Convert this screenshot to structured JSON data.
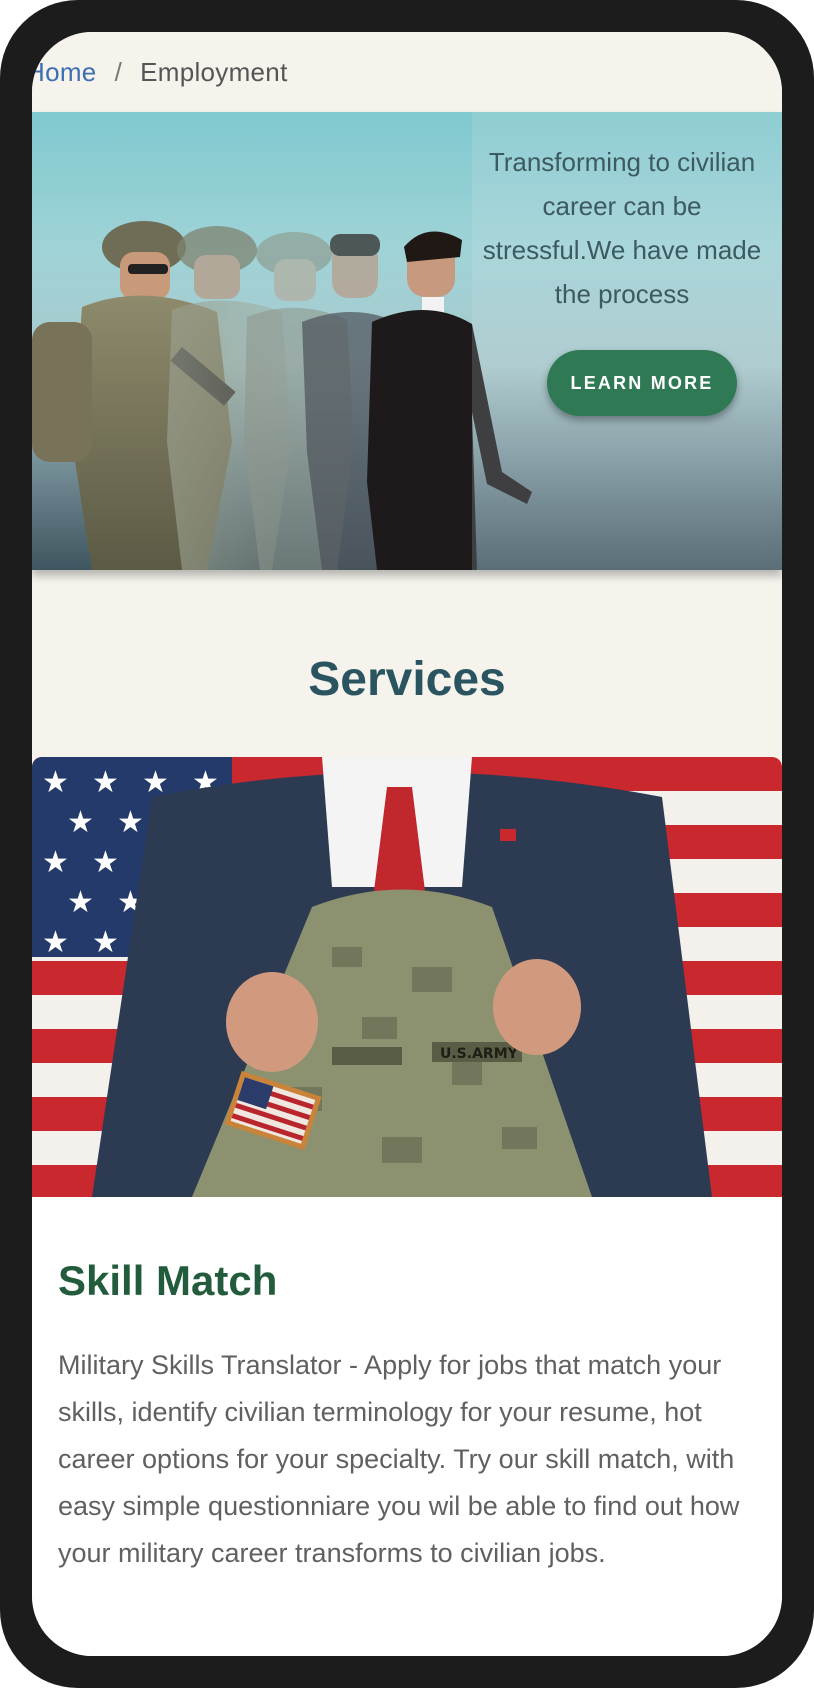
{
  "breadcrumb": {
    "home": "Home",
    "separator": "/",
    "current": "Employment"
  },
  "hero": {
    "text": "Transforming to civilian career can be stressful.We have made the process",
    "button_label": "LEARN MORE"
  },
  "services": {
    "title": "Services"
  },
  "card": {
    "title": "Skill Match",
    "body": "Military Skills Translator - Apply for jobs that match your skills, identify civilian terminology for your resume, hot career options for your specialty. Try our skill match, with easy simple questionniare you wil be able to find out  how your military career transforms to civilian jobs."
  },
  "colors": {
    "accent": "#2f7a55",
    "heading": "#2a5460",
    "card_title": "#225c3c",
    "link": "#3d6fb0"
  }
}
